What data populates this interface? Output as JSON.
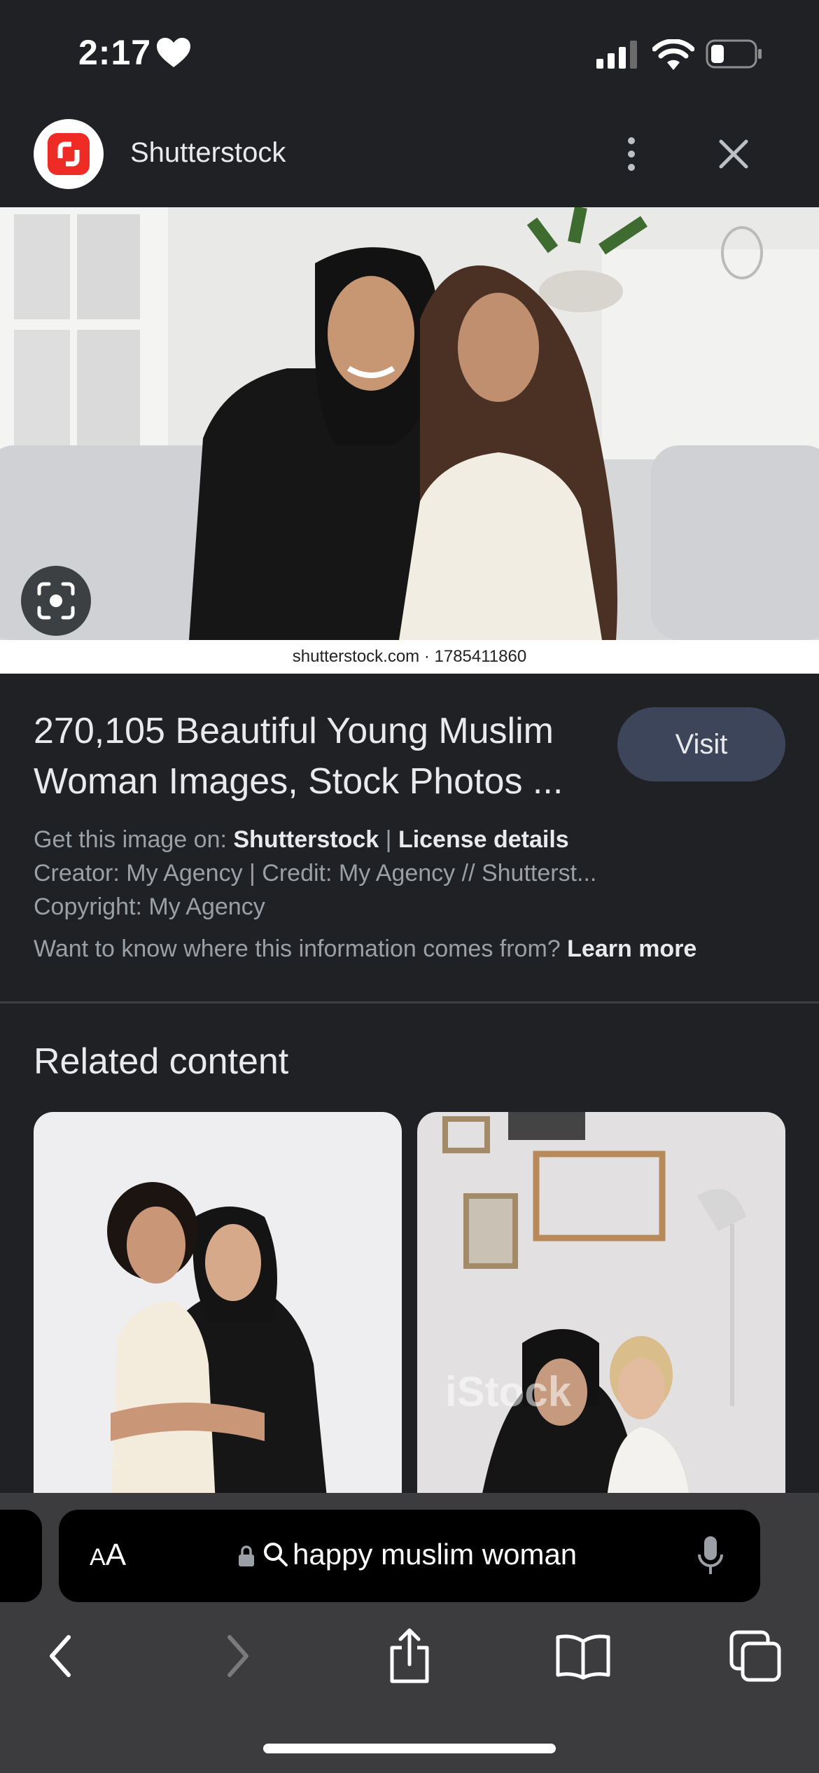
{
  "status_bar": {
    "time": "2:17"
  },
  "header": {
    "site_name": "Shutterstock"
  },
  "image": {
    "caption": "shutterstock.com · 1785411860"
  },
  "result": {
    "title": "270,105 Beautiful Young Muslim Woman Images, Stock Photos ...",
    "visit_label": "Visit",
    "get_image_prefix": "Get this image on: ",
    "get_image_source": "Shutterstock",
    "separator": " | ",
    "license_label": "License details",
    "creator_line": "Creator: My Agency | Credit: My Agency // Shutterst...",
    "copyright_line": "Copyright: My Agency",
    "info_question": "Want to know where this information comes from? ",
    "learn_more_label": "Learn more"
  },
  "related": {
    "heading": "Related content",
    "watermark": "iStock"
  },
  "address_bar": {
    "aa_small": "A",
    "aa_large": "A",
    "text": "happy muslim woman"
  },
  "colors": {
    "background": "#202124",
    "visit_button": "#3c4559",
    "toolbar": "#3c3c3e",
    "logo_red": "#ee2b24"
  }
}
